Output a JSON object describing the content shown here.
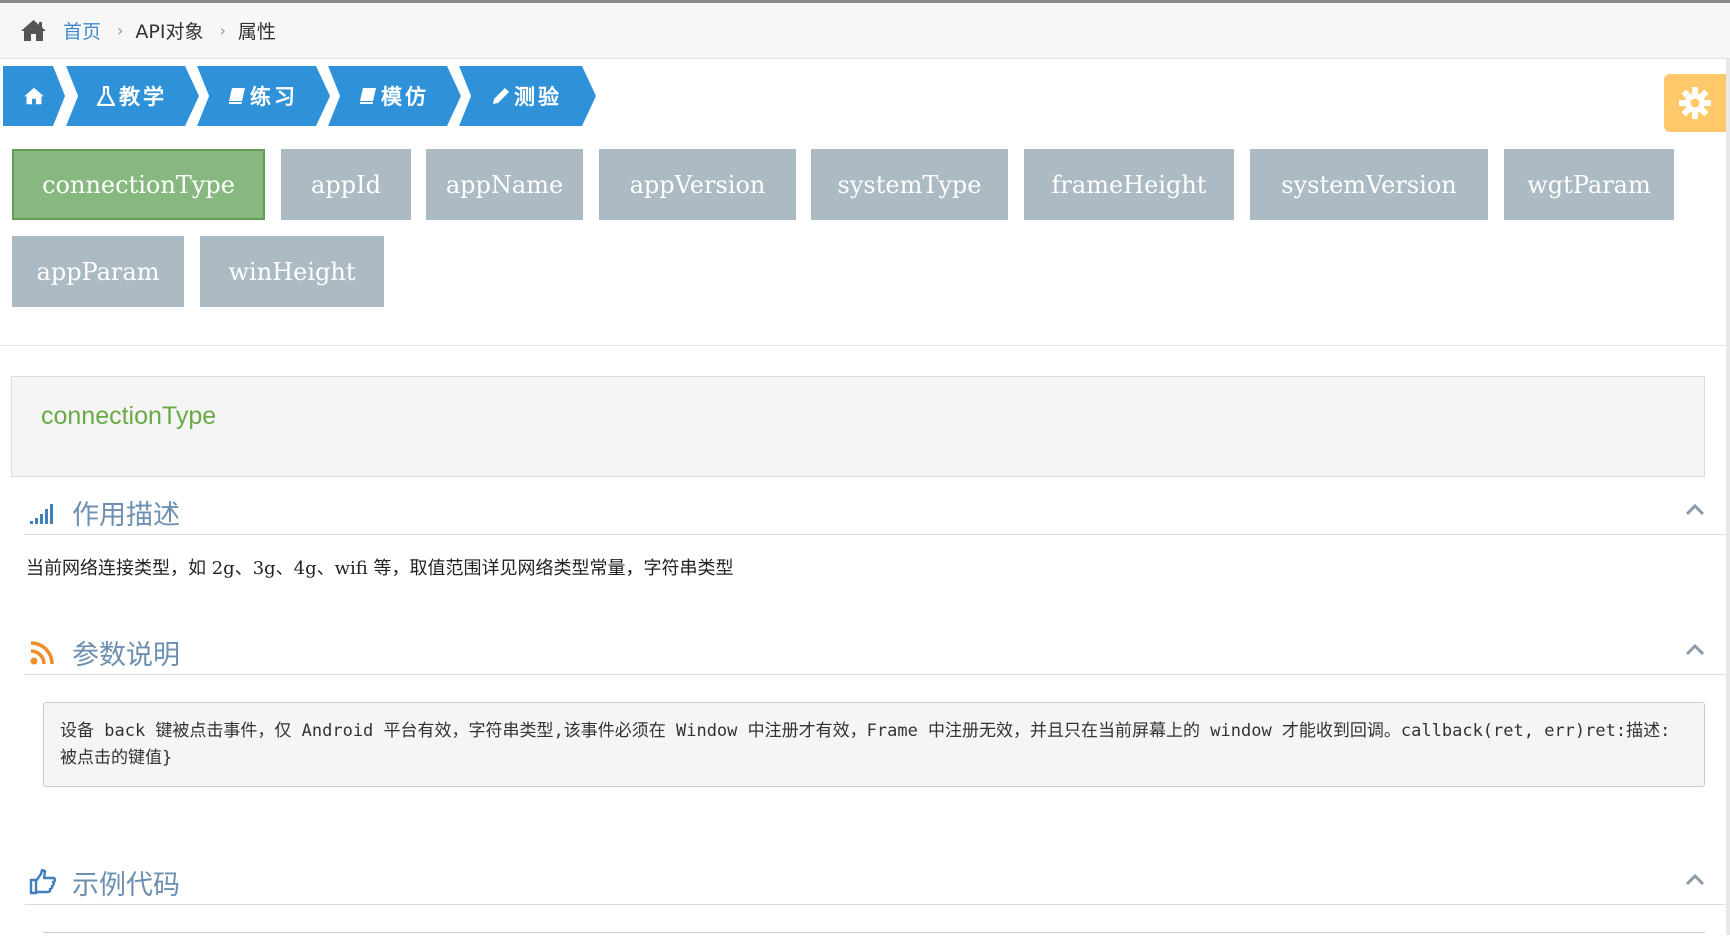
{
  "breadcrumb": {
    "home_label": "首页",
    "items": [
      "API对象",
      "属性"
    ]
  },
  "steps": [
    {
      "label": "",
      "icon": "home-icon"
    },
    {
      "label": "教学",
      "icon": "flask-icon"
    },
    {
      "label": "练习",
      "icon": "book-icon"
    },
    {
      "label": "模仿",
      "icon": "book-icon"
    },
    {
      "label": "测验",
      "icon": "pencil-icon"
    }
  ],
  "properties": [
    "connectionType",
    "appId",
    "appName",
    "appVersion",
    "systemType",
    "frameHeight",
    "systemVersion",
    "wgtParam",
    "appParam",
    "winHeight"
  ],
  "active_property": "connectionType",
  "detail": {
    "title": "connectionType",
    "sections": {
      "description": {
        "title": "作用描述",
        "text": "当前网络连接类型，如 2g、3g、4g、wifi 等，取值范围详见网络类型常量，字符串类型"
      },
      "params": {
        "title": "参数说明",
        "text": "设备 back 键被点击事件，仅 Android 平台有效，字符串类型,该事件必须在 Window 中注册才有效，Frame 中注册无效，并且只在当前屏幕上的 window 才能收到回调。callback(ret, err)ret:描述: 被点击的键值}"
      },
      "example": {
        "title": "示例代码"
      }
    }
  },
  "colors": {
    "step_blue": "#2f91d8",
    "active_green": "#87b87f",
    "inactive_grey": "#abbac3",
    "gear_orange": "#ffc96b",
    "title_green": "#69aa46",
    "section_blue": "#6d8fb0"
  }
}
